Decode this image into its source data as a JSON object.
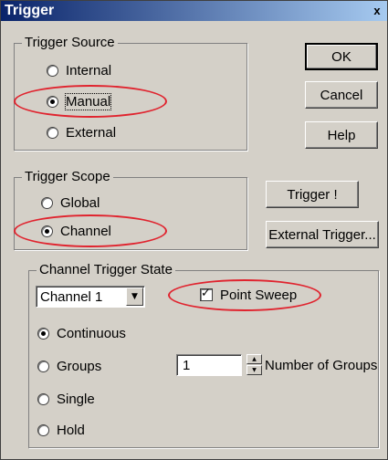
{
  "window": {
    "title": "Trigger",
    "close_glyph": "x"
  },
  "trigger_source": {
    "legend": "Trigger Source",
    "options": [
      {
        "label": "Internal",
        "selected": false
      },
      {
        "label": "Manual",
        "selected": true
      },
      {
        "label": "External",
        "selected": false
      }
    ]
  },
  "buttons": {
    "ok": "OK",
    "cancel": "Cancel",
    "help": "Help",
    "trigger": "Trigger !",
    "external_trigger": "External Trigger..."
  },
  "trigger_scope": {
    "legend": "Trigger Scope",
    "options": [
      {
        "label": "Global",
        "selected": false
      },
      {
        "label": "Channel",
        "selected": true
      }
    ]
  },
  "channel_trigger_state": {
    "legend": "Channel Trigger State",
    "channel_select": {
      "value": "Channel 1"
    },
    "point_sweep": {
      "label": "Point Sweep",
      "checked": true
    },
    "options": [
      {
        "label": "Continuous",
        "selected": true
      },
      {
        "label": "Groups",
        "selected": false
      },
      {
        "label": "Single",
        "selected": false
      },
      {
        "label": "Hold",
        "selected": false
      }
    ],
    "groups_count": {
      "value": "1",
      "label": "Number of Groups"
    }
  },
  "highlight_color": "#e0232e"
}
